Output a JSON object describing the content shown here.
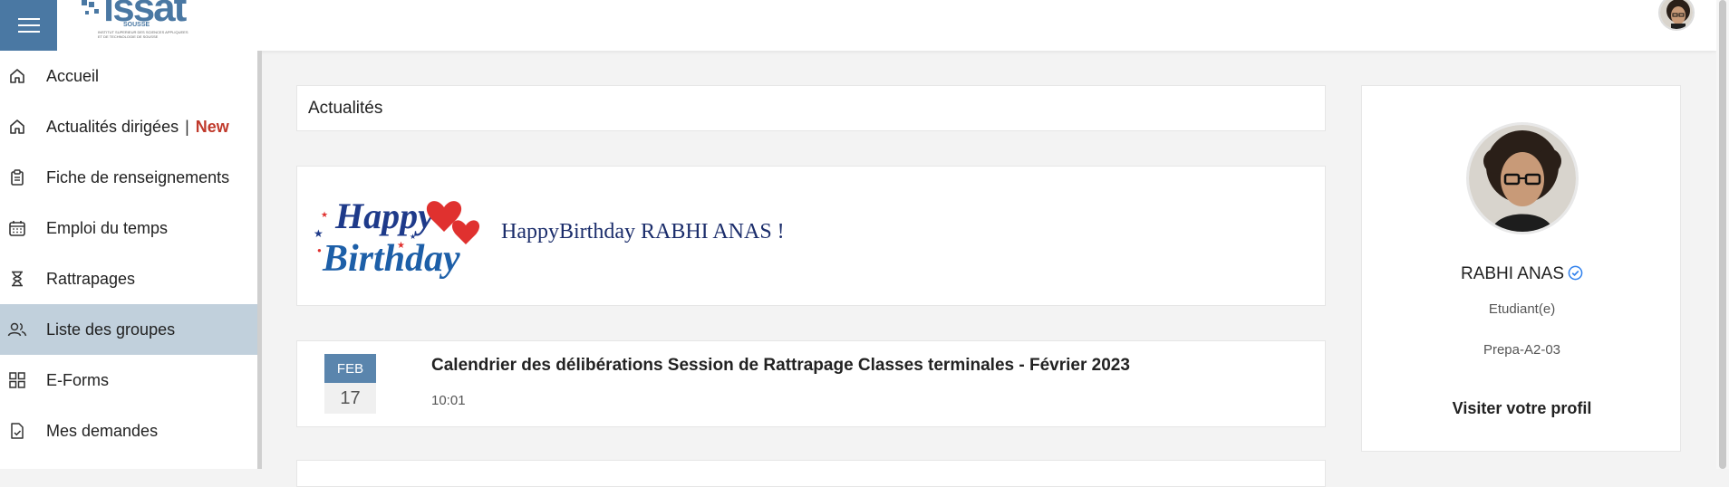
{
  "topbar": {
    "logo_text": "issat",
    "logo_sub": "SOUSSE",
    "logo_small": "INSTITUT SUPERIEUR DES SCIENCES APPLIQUEES ET DE TECHNOLOGIE DE SOUSSE"
  },
  "sidebar": {
    "items": [
      {
        "label": "Accueil",
        "icon": "home-icon"
      },
      {
        "label": "Actualités dirigées",
        "sep": "|",
        "badge": "New",
        "icon": "home-icon"
      },
      {
        "label": "Fiche de renseignements",
        "icon": "clipboard-icon"
      },
      {
        "label": "Emploi du temps",
        "icon": "calendar-icon"
      },
      {
        "label": "Rattrapages",
        "icon": "hourglass-icon"
      },
      {
        "label": "Liste des groupes",
        "icon": "users-icon",
        "active": true
      },
      {
        "label": "E-Forms",
        "icon": "grid-icon"
      },
      {
        "label": "Mes demandes",
        "icon": "document-check-icon"
      }
    ]
  },
  "main": {
    "section_title": "Actualités",
    "birthday": {
      "image_text_1": "Happy",
      "image_text_2": "Birthday",
      "message": "HappyBirthday RABHI ANAS !"
    },
    "news": [
      {
        "month": "FEB",
        "day": "17",
        "title": "Calendrier des délibérations Session de Rattrapage Classes terminales - Février 2023",
        "time": "10:01"
      }
    ]
  },
  "profile": {
    "name": "RABHI ANAS",
    "role": "Etudiant(e)",
    "group": "Prepa-A2-03",
    "link": "Visiter votre profil"
  },
  "colors": {
    "accent": "#4a78a3",
    "active_nav": "#c1d0dc",
    "badge_new": "#c0392b",
    "date_month_bg": "#5a85ad",
    "verified": "#2f80ed"
  }
}
